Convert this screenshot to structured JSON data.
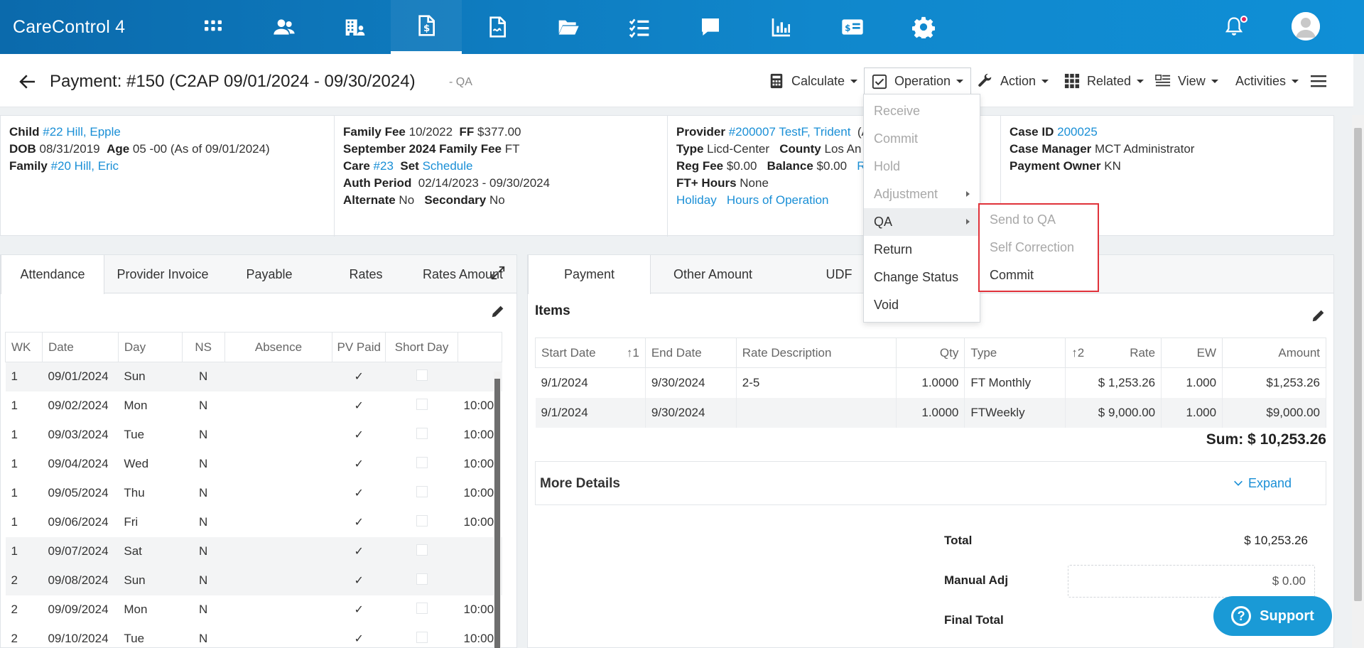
{
  "app": {
    "brand": "CareControl 4"
  },
  "nav": {
    "icons": [
      "apps-icon",
      "people-icon",
      "building-icon",
      "invoice-dollar-icon",
      "document-signature-icon",
      "folder-open-icon",
      "checklist-icon",
      "chat-icon",
      "bar-chart-icon",
      "id-card-dollar-icon",
      "gear-icon"
    ]
  },
  "header": {
    "title": "Payment: #150 (C2AP 09/01/2024 - 09/30/2024)",
    "subtitle": "- QA",
    "toolbar": {
      "calculate": "Calculate",
      "operation": "Operation",
      "action": "Action",
      "related": "Related",
      "view": "View",
      "activities": "Activities"
    }
  },
  "info": {
    "col1": {
      "child_label": "Child",
      "child_value": "#22 Hill, Epple",
      "dob_label": "DOB",
      "dob_value": "08/31/2019",
      "age_label": "Age",
      "age_value": "05 -00 (As of 09/01/2024)",
      "family_label": "Family",
      "family_value": "#20 Hill, Eric"
    },
    "col2": {
      "family_fee_label": "Family Fee",
      "family_fee_value": "10/2022",
      "ff_label": "FF",
      "ff_value": "$377.00",
      "sept_label": "September 2024 Family Fee",
      "sept_value": "FT",
      "care_label": "Care",
      "care_value": "#23",
      "set_label": "Set",
      "set_value": "Schedule",
      "auth_label": "Auth Period",
      "auth_value": "02/14/2023 - 09/30/2024",
      "alt_label": "Alternate",
      "alt_value": "No",
      "sec_label": "Secondary",
      "sec_value": "No"
    },
    "col3": {
      "provider_label": "Provider",
      "provider_value": "#200007 TestF, Trident",
      "provider_suffix": "(A",
      "type_label": "Type",
      "type_value": "Licd-Center",
      "county_label": "County",
      "county_value": "Los An",
      "regfee_label": "Reg Fee",
      "regfee_value": "$0.00",
      "balance_label": "Balance",
      "balance_value": "$0.00",
      "balance_suffix": "Re",
      "fthours_label": "FT+ Hours",
      "fthours_value": "None",
      "holiday": "Holiday",
      "hours_op": "Hours of Operation"
    },
    "col4": {
      "caseid_label": "Case ID",
      "caseid_value": "200025",
      "casemgr_label": "Case Manager",
      "casemgr_value": "MCT Administrator",
      "owner_label": "Payment Owner",
      "owner_value": "KN"
    }
  },
  "left_tabs": [
    "Attendance",
    "Provider Invoice",
    "Payable",
    "Rates",
    "Rates Amount"
  ],
  "attendance": {
    "columns": [
      "WK",
      "Date",
      "Day",
      "NS",
      "Absence",
      "PV Paid",
      "Short Day",
      ""
    ],
    "rows": [
      {
        "wk": "1",
        "date": "09/01/2024",
        "day": "Sun",
        "ns": "N",
        "paid": "✓",
        "extra": ""
      },
      {
        "wk": "1",
        "date": "09/02/2024",
        "day": "Mon",
        "ns": "N",
        "paid": "✓",
        "extra": "10:00"
      },
      {
        "wk": "1",
        "date": "09/03/2024",
        "day": "Tue",
        "ns": "N",
        "paid": "✓",
        "extra": "10:00"
      },
      {
        "wk": "1",
        "date": "09/04/2024",
        "day": "Wed",
        "ns": "N",
        "paid": "✓",
        "extra": "10:00"
      },
      {
        "wk": "1",
        "date": "09/05/2024",
        "day": "Thu",
        "ns": "N",
        "paid": "✓",
        "extra": "10:00"
      },
      {
        "wk": "1",
        "date": "09/06/2024",
        "day": "Fri",
        "ns": "N",
        "paid": "✓",
        "extra": "10:00"
      },
      {
        "wk": "1",
        "date": "09/07/2024",
        "day": "Sat",
        "ns": "N",
        "paid": "✓",
        "extra": ""
      },
      {
        "wk": "2",
        "date": "09/08/2024",
        "day": "Sun",
        "ns": "N",
        "paid": "✓",
        "extra": ""
      },
      {
        "wk": "2",
        "date": "09/09/2024",
        "day": "Mon",
        "ns": "N",
        "paid": "✓",
        "extra": "10:00"
      },
      {
        "wk": "2",
        "date": "09/10/2024",
        "day": "Tue",
        "ns": "N",
        "paid": "✓",
        "extra": "10:00"
      }
    ]
  },
  "right_tabs": [
    "Payment",
    "Other Amount",
    "UDF"
  ],
  "items": {
    "title": "Items",
    "columns": {
      "start": "Start Date",
      "sort1": "↑1",
      "end": "End Date",
      "desc": "Rate Description",
      "qty": "Qty",
      "type": "Type",
      "sort2": "↑2",
      "rate": "Rate",
      "ew": "EW",
      "amount": "Amount"
    },
    "rows": [
      {
        "start": "9/1/2024",
        "end": "9/30/2024",
        "desc": "2-5",
        "qty": "1.0000",
        "type": "FT Monthly",
        "rate": "$ 1,253.26",
        "ew": "1.000",
        "amount": "$1,253.26"
      },
      {
        "start": "9/1/2024",
        "end": "9/30/2024",
        "desc": "",
        "qty": "1.0000",
        "type": "FTWeekly",
        "rate": "$ 9,000.00",
        "ew": "1.000",
        "amount": "$9,000.00"
      }
    ],
    "sum": "Sum: $ 10,253.26"
  },
  "details": {
    "label": "More Details",
    "expand": "Expand"
  },
  "totals": {
    "total_label": "Total",
    "total_value": "$ 10,253.26",
    "manual_label": "Manual Adj",
    "manual_value": "$ 0.00",
    "final_label": "Final Total"
  },
  "operation_menu": [
    {
      "label": "Receive",
      "disabled": true
    },
    {
      "label": "Commit",
      "disabled": true
    },
    {
      "label": "Hold",
      "disabled": true
    },
    {
      "label": "Adjustment",
      "disabled": true
    },
    {
      "label": "QA",
      "disabled": false
    },
    {
      "label": "Return",
      "disabled": false
    },
    {
      "label": "Change Status",
      "disabled": false
    },
    {
      "label": "Void",
      "disabled": false
    }
  ],
  "qa_submenu": [
    {
      "label": "Send to QA",
      "disabled": true
    },
    {
      "label": "Self Correction",
      "disabled": true
    },
    {
      "label": "Commit",
      "disabled": false
    }
  ],
  "support": {
    "label": "Support"
  },
  "colors": {
    "nav": "#0b6aac",
    "link": "#1a8fd6",
    "highlight": "#e0323a",
    "support": "#1a9ad6"
  }
}
